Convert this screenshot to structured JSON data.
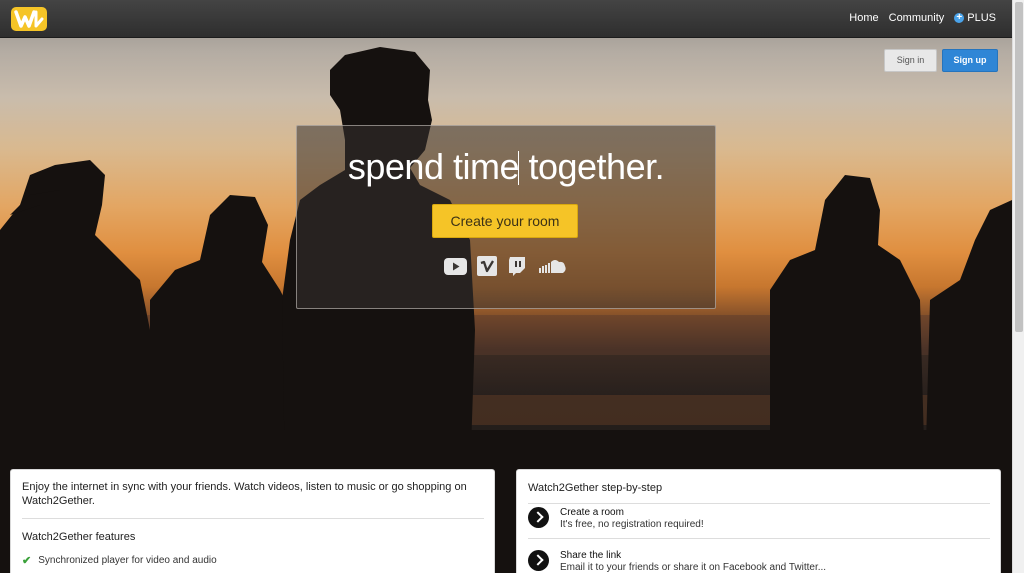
{
  "topbar": {
    "logo_icon": "watch2gether-logo-icon",
    "nav": [
      {
        "label": "Home"
      },
      {
        "label": "Community"
      },
      {
        "label": "PLUS",
        "icon": "plus-circle-icon"
      }
    ]
  },
  "auth": {
    "signin_label": "Sign in",
    "signup_label": "Sign up"
  },
  "hero": {
    "headline": "spend time together.",
    "create_button": "Create your room",
    "services": [
      "youtube-icon",
      "vimeo-icon",
      "twitch-icon",
      "soundcloud-icon"
    ]
  },
  "features_card": {
    "intro": "Enjoy the internet in sync with your friends. Watch videos, listen to music or go shopping on Watch2Gether.",
    "heading": "Watch2Gether features",
    "items": [
      {
        "label": "Synchronized player for video and audio"
      }
    ]
  },
  "steps_card": {
    "heading": "Watch2Gether step-by-step",
    "steps": [
      {
        "title": "Create a room",
        "desc": "It's free, no registration required!"
      },
      {
        "title": "Share the link",
        "desc": "Email it to your friends or share it on Facebook and Twitter..."
      }
    ]
  },
  "colors": {
    "accent_yellow": "#f5c427",
    "signup_blue": "#2f86d6",
    "topbar": "#333333"
  }
}
